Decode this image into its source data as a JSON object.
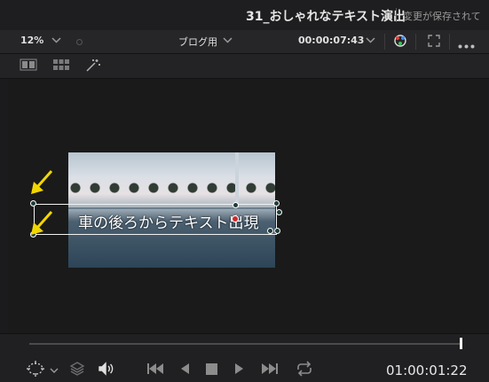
{
  "window": {
    "project_title": "31_おしゃれなテキスト演出",
    "save_status": "変更が保存されて"
  },
  "viewer_header": {
    "zoom": "12%",
    "timeline_name": "ブログ用",
    "timecode": "00:00:07:43"
  },
  "viewer": {
    "overlay_text": "車の後ろからテキスト出現"
  },
  "transport": {
    "timecode": "01:00:01:22"
  },
  "colors": {
    "accent_arrow": "#f2d600",
    "anchor": "#d1282b",
    "background": "#1b1b1d"
  },
  "icons": [
    "dropdown-chevron-icon",
    "color-wheel-icon",
    "fullscreen-icon",
    "more-options-icon",
    "dual-view-icon",
    "grid-view-icon",
    "magic-wand-icon",
    "transform-tool-icon",
    "layers-icon",
    "speaker-icon",
    "jump-start-icon",
    "play-reverse-icon",
    "stop-icon",
    "play-icon",
    "jump-end-icon",
    "loop-icon",
    "yellow-arrow-icon"
  ]
}
